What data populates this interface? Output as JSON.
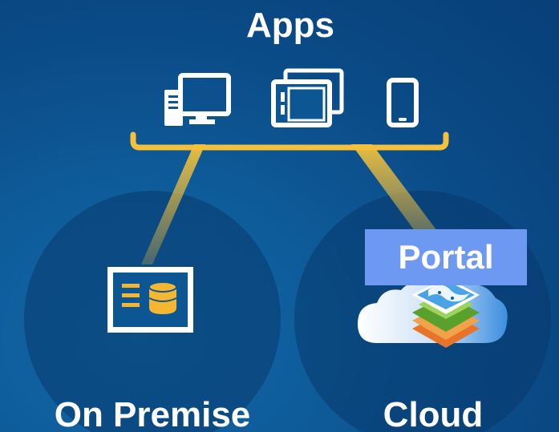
{
  "title": "Apps",
  "on_premise": {
    "label": "On Premise"
  },
  "cloud": {
    "label": "Cloud"
  },
  "portal": {
    "label": "Portal"
  },
  "icons": {
    "desktop": "desktop-computer-icon",
    "tablet": "tablet-icon",
    "phone": "mobile-phone-icon",
    "server": "server-database-icon",
    "cloud": "cloud-icon",
    "layers": "map-layers-icon"
  },
  "colors": {
    "background": "#0a4a86",
    "connector": "#f5c13a",
    "portal_box": "#6d99f2",
    "circle": "#083a6e",
    "database": "#f5b731"
  }
}
